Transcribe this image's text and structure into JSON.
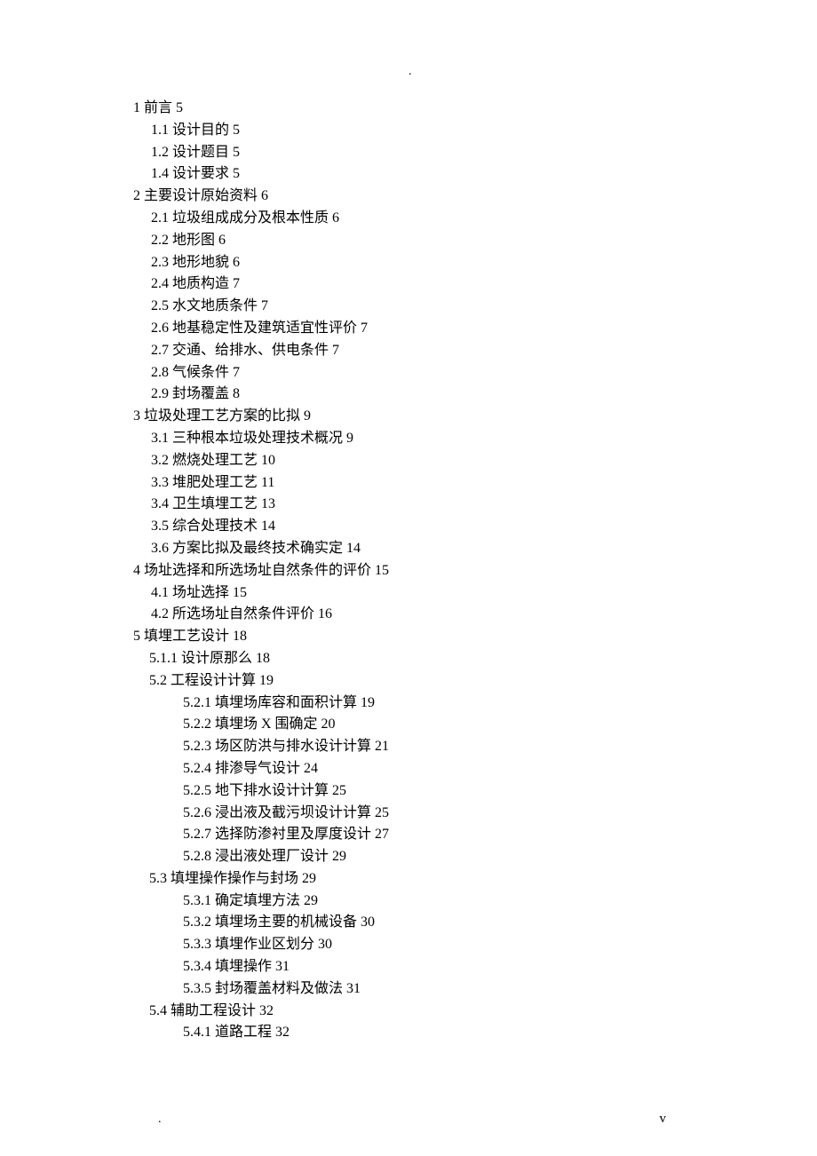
{
  "header_dot": ".",
  "footer_dot": ".",
  "page_marker": "v",
  "toc": [
    {
      "lvl": "l0",
      "text": "1  前言 5"
    },
    {
      "lvl": "l1",
      "text": "1.1 设计目的 5"
    },
    {
      "lvl": "l1",
      "text": "1.2 设计题目 5"
    },
    {
      "lvl": "l1",
      "text": "1.4  设计要求 5"
    },
    {
      "lvl": "l0",
      "text": "2  主要设计原始资料 6"
    },
    {
      "lvl": "l1",
      "text": "2.1  垃圾组成成分及根本性质 6"
    },
    {
      "lvl": "l1",
      "text": "2.2  地形图 6"
    },
    {
      "lvl": "l1",
      "text": "2.3  地形地貌 6"
    },
    {
      "lvl": "l1",
      "text": "2.4  地质构造 7"
    },
    {
      "lvl": "l1",
      "text": "2.5  水文地质条件 7"
    },
    {
      "lvl": "l1",
      "text": "2.6  地基稳定性及建筑适宜性评价 7"
    },
    {
      "lvl": "l1",
      "text": "2.7  交通、给排水、供电条件 7"
    },
    {
      "lvl": "l1",
      "text": "2.8  气候条件 7"
    },
    {
      "lvl": "l1",
      "text": "2.9  封场覆盖 8"
    },
    {
      "lvl": "l0",
      "text": "3  垃圾处理工艺方案的比拟 9"
    },
    {
      "lvl": "l1",
      "text": "3.1 三种根本垃圾处理技术概况 9"
    },
    {
      "lvl": "l1",
      "text": "3.2 燃烧处理工艺 10"
    },
    {
      "lvl": "l1",
      "text": "3.3 堆肥处理工艺 11"
    },
    {
      "lvl": "l1",
      "text": "3.4 卫生填埋工艺 13"
    },
    {
      "lvl": "l1",
      "text": "3.5 综合处理技术 14"
    },
    {
      "lvl": "l1",
      "text": "3.6  方案比拟及最终技术确实定 14"
    },
    {
      "lvl": "l0",
      "text": "4  场址选择和所选场址自然条件的评价 15"
    },
    {
      "lvl": "l1",
      "text": "4.1 场址选择 15"
    },
    {
      "lvl": "l1",
      "text": "4.2 所选场址自然条件评价 16"
    },
    {
      "lvl": "l0",
      "text": "5  填埋工艺设计 18"
    },
    {
      "lvl": "l1b",
      "text": "5.1.1    设计原那么 18"
    },
    {
      "lvl": "l1b",
      "text": "5.2 工程设计计算 19"
    },
    {
      "lvl": "l2",
      "text": "5.2.1  填埋场库容和面积计算 19"
    },
    {
      "lvl": "l2",
      "text": "5.2.2  填埋场 X 围确定 20"
    },
    {
      "lvl": "l2",
      "text": "5.2.3  场区防洪与排水设计计算 21"
    },
    {
      "lvl": "l2",
      "text": "5.2.4  排渗导气设计 24"
    },
    {
      "lvl": "l2",
      "text": "5.2.5  地下排水设计计算 25"
    },
    {
      "lvl": "l2",
      "text": "5.2.6  浸出液及截污坝设计计算 25"
    },
    {
      "lvl": "l2",
      "text": "5.2.7  选择防渗衬里及厚度设计 27"
    },
    {
      "lvl": "l2",
      "text": "5.2.8  浸出液处理厂设计 29"
    },
    {
      "lvl": "l1b",
      "text": "5.3  填埋操作操作与封场 29"
    },
    {
      "lvl": "l2",
      "text": "5.3.1  确定填埋方法 29"
    },
    {
      "lvl": "l2",
      "text": "5.3.2  填埋场主要的机械设备 30"
    },
    {
      "lvl": "l2",
      "text": "5.3.3  填埋作业区划分 30"
    },
    {
      "lvl": "l2",
      "text": "5.3.4  填埋操作 31"
    },
    {
      "lvl": "l2",
      "text": "5.3.5  封场覆盖材料及做法 31"
    },
    {
      "lvl": "l1b",
      "text": "5.4  辅助工程设计 32"
    },
    {
      "lvl": "l2",
      "text": "5.4.1  道路工程 32"
    }
  ]
}
